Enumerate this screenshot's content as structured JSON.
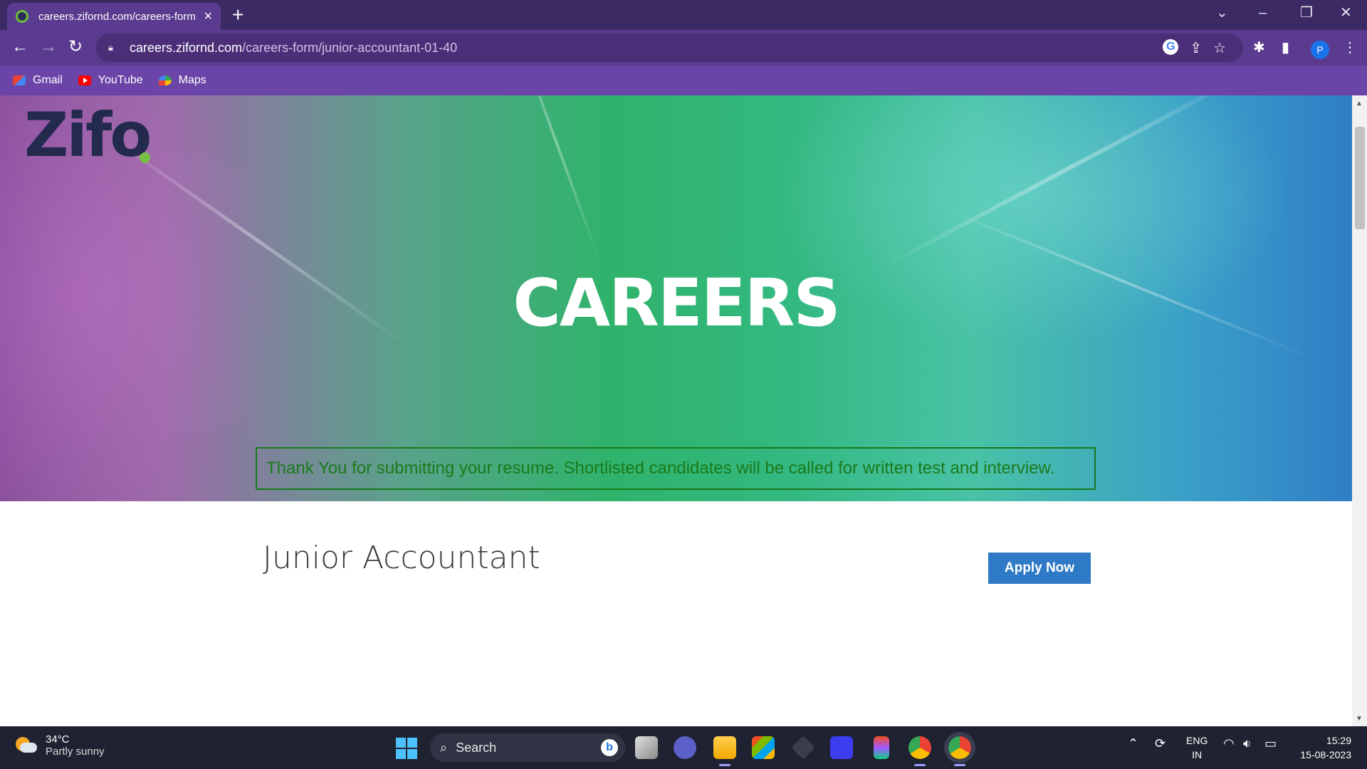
{
  "browser": {
    "tab_title": "careers.zifornd.com/careers-form",
    "new_tab_symbol": "+",
    "url_host": "careers.zifornd.com",
    "url_path": "/careers-form/junior-accountant-01-40",
    "profile_initial": "P",
    "bookmarks": [
      {
        "label": "Gmail",
        "icon": "gmail-icon"
      },
      {
        "label": "YouTube",
        "icon": "youtube-icon"
      },
      {
        "label": "Maps",
        "icon": "maps-icon"
      }
    ]
  },
  "page": {
    "logo_text": "Zifo",
    "hero_title": "CAREERS",
    "success_message": "Thank You for submitting your resume. Shortlisted candidates will be called for written test and interview.",
    "job_title": "Junior Accountant",
    "apply_label": "Apply Now"
  },
  "taskbar": {
    "temperature": "34°C",
    "weather": "Partly sunny",
    "search_label": "Search",
    "language": "ENG",
    "region": "IN",
    "time": "15:29",
    "date": "15-08-2023"
  },
  "colors": {
    "tab_bar": "#3b2a63",
    "toolbar": "#5a3b8f",
    "bookmarks_bar": "#6b44a8",
    "alert_border": "#157a1a",
    "apply_button": "#2e7ac6",
    "taskbar": "#1f2230"
  }
}
